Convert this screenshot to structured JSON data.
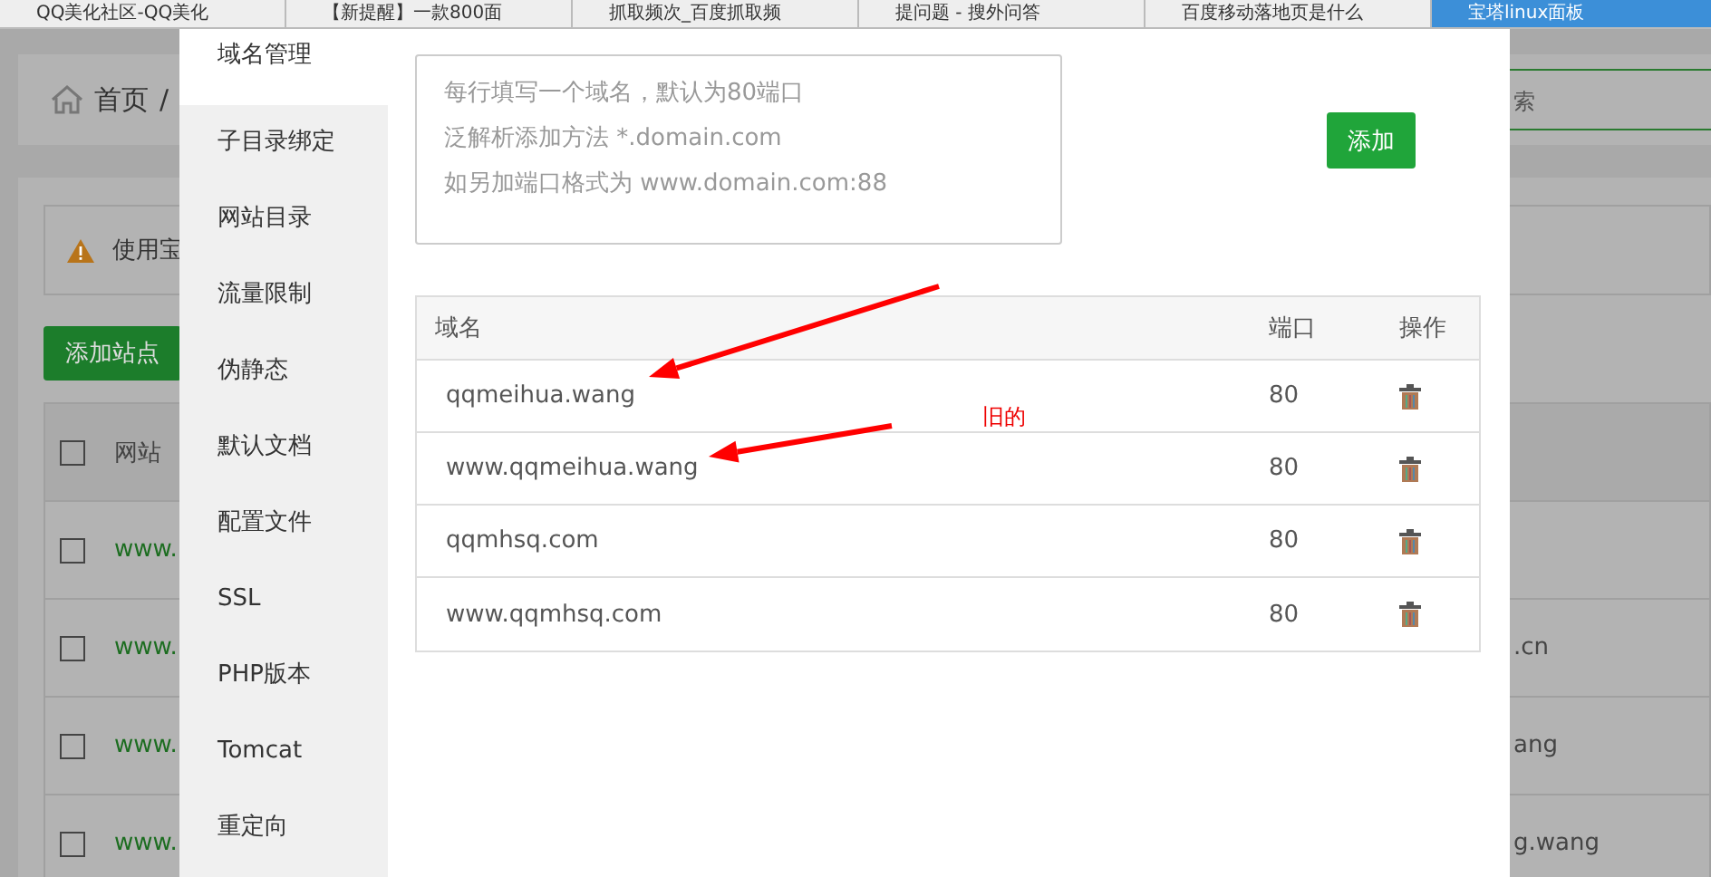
{
  "browser_tabs": [
    {
      "title": "QQ美化社区-QQ美化",
      "active": false
    },
    {
      "title": "【新提醒】一款800面",
      "active": false
    },
    {
      "title": "抓取频次_百度抓取频",
      "active": false
    },
    {
      "title": "提问题 - 搜外问答",
      "active": false
    },
    {
      "title": "百度移动落地页是什么",
      "active": false
    },
    {
      "title": "宝塔linux面板",
      "active": true
    }
  ],
  "background": {
    "breadcrumb": {
      "home": "首页",
      "separator": "/"
    },
    "search": {
      "placeholder": "索"
    },
    "alert": "使用宝",
    "add_button": "添加站点",
    "table_header": "网站",
    "header_checked": false,
    "rows": [
      {
        "name": "www.",
        "checked": false
      },
      {
        "name": "www.",
        "tail": ".cn",
        "checked": false
      },
      {
        "name": "www.",
        "tail": "ang",
        "checked": false
      },
      {
        "name": "www.",
        "tail": "g.wang",
        "checked": false
      }
    ]
  },
  "modal": {
    "menu": [
      {
        "label": "域名管理",
        "selected": true
      },
      {
        "label": "子目录绑定",
        "selected": false
      },
      {
        "label": "网站目录",
        "selected": false
      },
      {
        "label": "流量限制",
        "selected": false
      },
      {
        "label": "伪静态",
        "selected": false
      },
      {
        "label": "默认文档",
        "selected": false
      },
      {
        "label": "配置文件",
        "selected": false
      },
      {
        "label": "SSL",
        "selected": false
      },
      {
        "label": "PHP版本",
        "selected": false
      },
      {
        "label": "Tomcat",
        "selected": false
      },
      {
        "label": "重定向",
        "selected": false
      }
    ],
    "domain_input": {
      "placeholder": [
        "每行填写一个域名，默认为80端口",
        "泛解析添加方法 *.domain.com",
        "如另加端口格式为 www.domain.com:88"
      ]
    },
    "add_button": "添加",
    "table": {
      "columns": [
        "域名",
        "端口",
        "操作"
      ],
      "rows": [
        {
          "domain": "qqmeihua.wang",
          "port": "80"
        },
        {
          "domain": "www.qqmeihua.wang",
          "port": "80"
        },
        {
          "domain": "qqmhsq.com",
          "port": "80"
        },
        {
          "domain": "www.qqmhsq.com",
          "port": "80"
        }
      ]
    }
  },
  "annotation": {
    "note": "旧的"
  }
}
